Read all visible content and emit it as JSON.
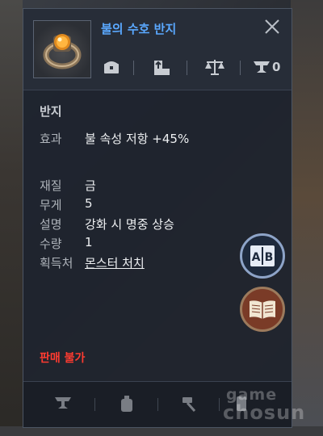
{
  "item": {
    "name": "불의 수호 반지",
    "category": "반지",
    "icon": "ring-with-orange-gem-icon"
  },
  "header_icons": [
    {
      "name": "chest-icon"
    },
    {
      "name": "upgrade-tower-icon"
    },
    {
      "name": "scale-icon"
    },
    {
      "name": "anvil-icon",
      "count": "0"
    }
  ],
  "stats": {
    "effect": {
      "label": "효과",
      "value": "불 속성 저항 +45%"
    },
    "material": {
      "label": "재질",
      "value": "금"
    },
    "weight": {
      "label": "무게",
      "value": "5"
    },
    "description": {
      "label": "설명",
      "value": "강화 시 명중 상승"
    },
    "quantity": {
      "label": "수량",
      "value": "1"
    },
    "source": {
      "label": "획득처",
      "value": "몬스터 처치"
    }
  },
  "actions": {
    "compare_label": "A|B",
    "book_icon": "book-icon"
  },
  "notice": "판매 불가",
  "footer_icons": [
    "anvil-icon",
    "potion-icon",
    "hammer-icon",
    "scroll-icon"
  ],
  "watermark": {
    "line1": "game",
    "line2": "chosun"
  },
  "colors": {
    "title": "#5aa8ff",
    "link": "#4aa3ff",
    "warning": "#ff3b30",
    "panel": "#1e242e"
  }
}
